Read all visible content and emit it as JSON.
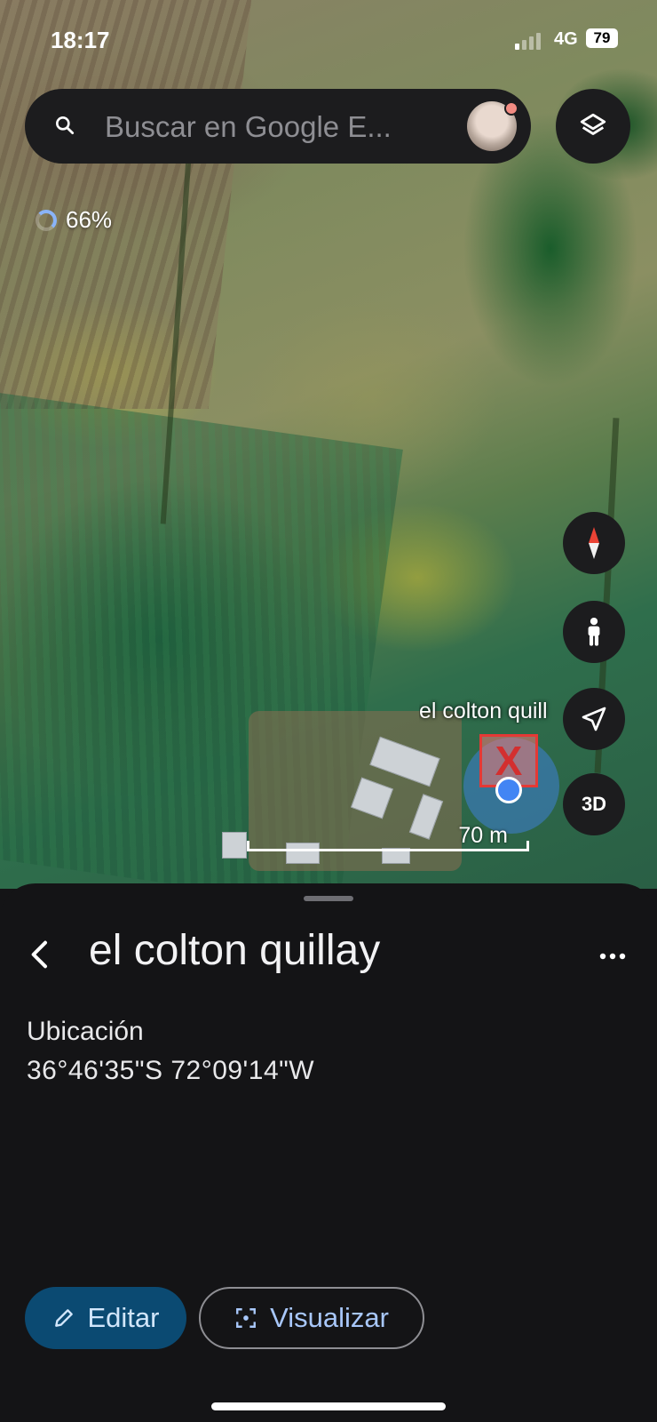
{
  "status_bar": {
    "time": "18:17",
    "network": "4G",
    "battery": "79"
  },
  "search": {
    "placeholder": "Buscar en Google E..."
  },
  "loading": {
    "progress_text": "66%",
    "progress_value": 0.66
  },
  "map": {
    "pin_label": "el colton quill",
    "pin_marker": "X",
    "scale_label": "70 m",
    "controls": {
      "compass_icon": "compass-icon",
      "street_view_icon": "pegman-icon",
      "my_location_icon": "navigation-arrow-icon",
      "label_3d": "3D"
    },
    "layers_icon": "layers-icon"
  },
  "sheet": {
    "title": "el colton quillay",
    "location_label": "Ubicación",
    "coordinates": "36°46'35\"S 72°09'14\"W",
    "edit_label": "Editar",
    "view_label": "Visualizar"
  },
  "colors": {
    "accent_blue": "#4285f4",
    "edit_button_bg": "#0b4a72",
    "view_button_text": "#a8c7fa",
    "sheet_bg": "#141416",
    "marker_red": "#e53935"
  }
}
